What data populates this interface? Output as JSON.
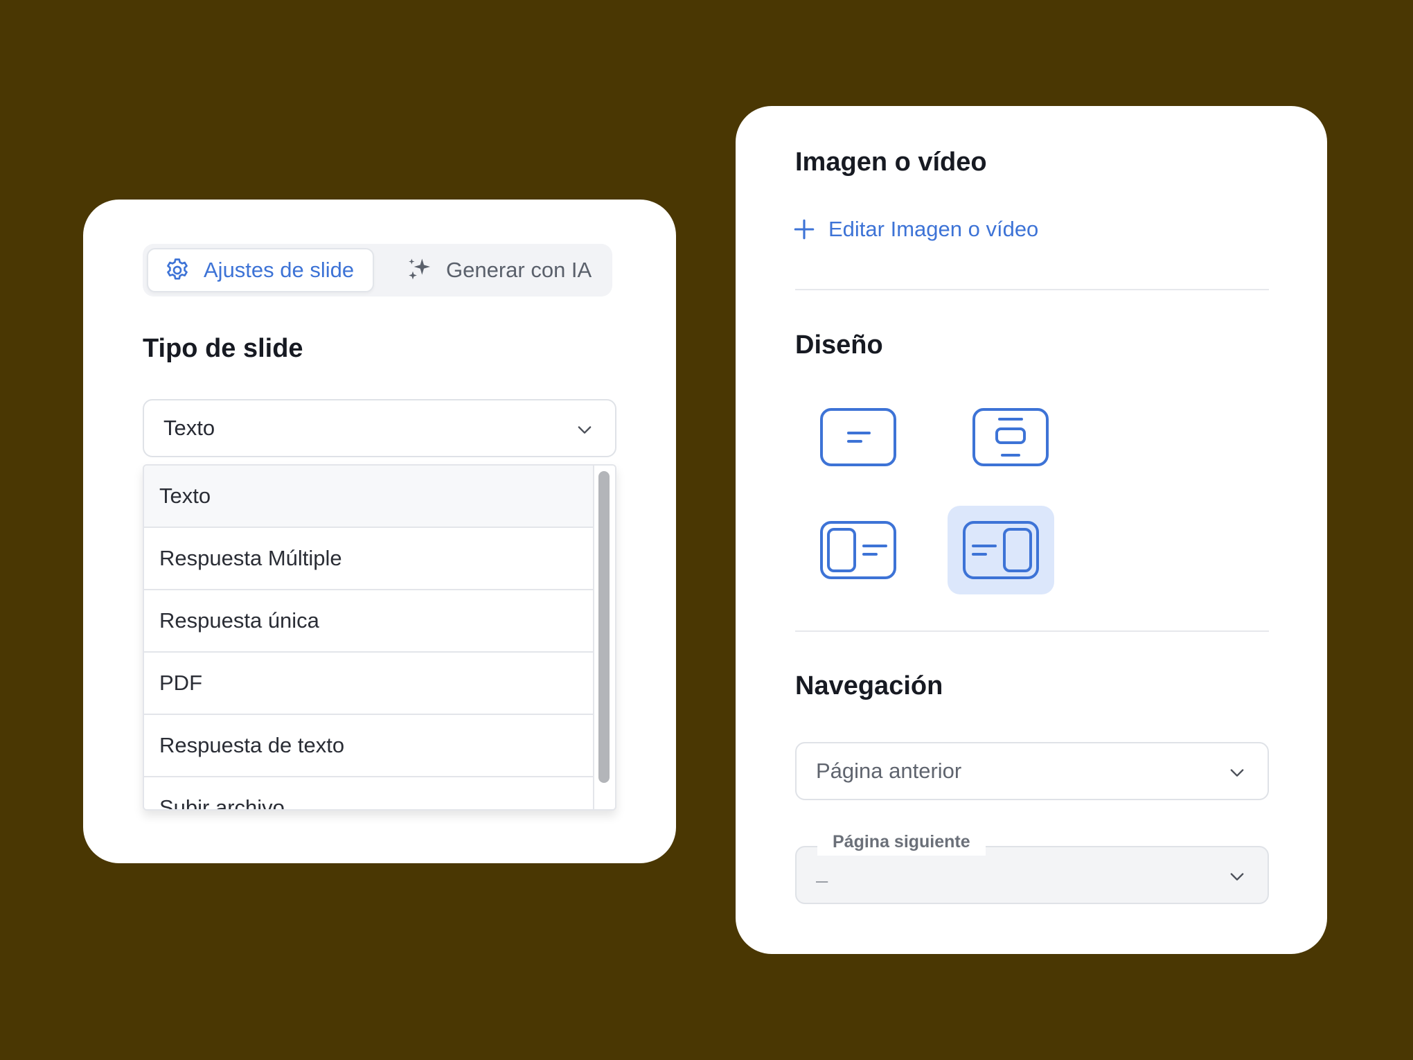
{
  "slide_settings": {
    "tabs": [
      {
        "label": "Ajustes de slide",
        "icon": "gear-icon",
        "active": true
      },
      {
        "label": "Generar con IA",
        "icon": "sparkles-icon",
        "active": false
      }
    ],
    "section_title": "Tipo de slide",
    "type_select": {
      "value": "Texto",
      "options": [
        "Texto",
        "Respuesta Múltiple",
        "Respuesta única",
        "PDF",
        "Respuesta de texto",
        "Subir archivo"
      ]
    }
  },
  "panel": {
    "media_title": "Imagen o vídeo",
    "media_action": "Editar Imagen o vídeo",
    "design_title": "Diseño",
    "layouts": [
      {
        "name": "text-centered",
        "selected": false
      },
      {
        "name": "text-with-media-top",
        "selected": false
      },
      {
        "name": "media-left-text-right",
        "selected": false
      },
      {
        "name": "text-left-media-right",
        "selected": true
      }
    ],
    "navigation_title": "Navegación",
    "prev_select": {
      "value": "Página anterior"
    },
    "next_select": {
      "label": "Página siguiente",
      "value": "–"
    }
  },
  "colors": {
    "background": "#4a3703",
    "accent": "#3d73d6",
    "selected_layout_bg": "#dce7fb"
  }
}
